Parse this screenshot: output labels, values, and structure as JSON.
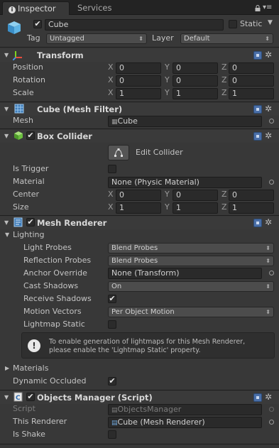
{
  "tabs": {
    "inspector": "Inspector",
    "services": "Services"
  },
  "header": {
    "object_name": "Cube",
    "static_label": "Static",
    "tag_label": "Tag",
    "tag_value": "Untagged",
    "layer_label": "Layer",
    "layer_value": "Default"
  },
  "transform": {
    "title": "Transform",
    "position_label": "Position",
    "rotation_label": "Rotation",
    "scale_label": "Scale",
    "axis_x": "X",
    "axis_y": "Y",
    "axis_z": "Z",
    "position": {
      "x": "0",
      "y": "0",
      "z": "0"
    },
    "rotation": {
      "x": "0",
      "y": "0",
      "z": "0"
    },
    "scale": {
      "x": "1",
      "y": "1",
      "z": "1"
    }
  },
  "mesh_filter": {
    "title": "Cube (Mesh Filter)",
    "mesh_label": "Mesh",
    "mesh_value": "Cube"
  },
  "box_collider": {
    "title": "Box Collider",
    "edit_collider": "Edit Collider",
    "is_trigger_label": "Is Trigger",
    "material_label": "Material",
    "material_value": "None (Physic Material)",
    "center_label": "Center",
    "size_label": "Size",
    "center": {
      "x": "0",
      "y": "0",
      "z": "0"
    },
    "size": {
      "x": "1",
      "y": "1",
      "z": "1"
    }
  },
  "mesh_renderer": {
    "title": "Mesh Renderer",
    "lighting_label": "Lighting",
    "light_probes_label": "Light Probes",
    "light_probes_value": "Blend Probes",
    "reflection_probes_label": "Reflection Probes",
    "reflection_probes_value": "Blend Probes",
    "anchor_override_label": "Anchor Override",
    "anchor_override_value": "None (Transform)",
    "cast_shadows_label": "Cast Shadows",
    "cast_shadows_value": "On",
    "receive_shadows_label": "Receive Shadows",
    "motion_vectors_label": "Motion Vectors",
    "motion_vectors_value": "Per Object Motion",
    "lightmap_static_label": "Lightmap Static",
    "note_line1": "To enable generation of lightmaps for this Mesh Renderer,",
    "note_line2": "please enable the 'Lightmap Static' property.",
    "materials_label": "Materials",
    "dynamic_occluded_label": "Dynamic Occluded"
  },
  "objects_manager": {
    "title": "Objects Manager (Script)",
    "script_label": "Script",
    "script_value": "ObjectsManager",
    "this_renderer_label": "This Renderer",
    "this_renderer_value": "Cube (Mesh Renderer)",
    "is_shake_label": "Is Shake"
  },
  "checkmark": "✔",
  "colors": {
    "background": "#383838",
    "field": "#2a2a2a",
    "help_icon": "#4a6fa8"
  }
}
